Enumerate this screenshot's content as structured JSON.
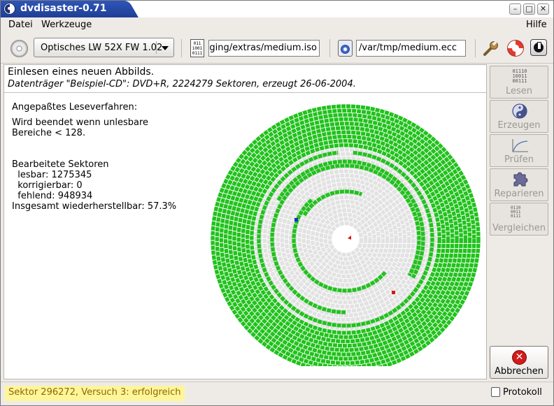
{
  "window": {
    "title": "dvdisaster-0.71",
    "controls": [
      "–",
      "□",
      "✕"
    ]
  },
  "menu": {
    "file": "Datei",
    "tools": "Werkzeuge",
    "help": "Hilfe"
  },
  "toolbar": {
    "drive": "Optisches LW 52X FW 1.02",
    "image_path": "aging/extras/medium.iso",
    "ecc_path": "/var/tmp/medium.ecc",
    "image_icon_text": "011\n1001\n0111"
  },
  "main": {
    "heading": "Einlesen eines neuen Abbilds.",
    "subheading": "Datenträger \"Beispiel-CD\": DVD+R, 2224279 Sektoren, erzeugt 26-06-2004.",
    "method_label": "Angepaßtes Leseverfahren:",
    "stop_line1": "Wird beendet wenn unlesbare",
    "stop_line2": "Bereiche < 128.",
    "processed_label": "Bearbeitete Sektoren",
    "readable": "  lesbar: 1275345",
    "correctable": "  korrigierbar: 0",
    "missing": "  fehlend: 948934",
    "recoverable": "Insgesamt wiederherstellbar: 57.3%"
  },
  "sidebar": {
    "read": "Lesen",
    "read_icon_text": "01110\n10011\n00111",
    "create": "Erzeugen",
    "verify": "Prüfen",
    "repair": "Reparieren",
    "compare": "Vergleichen",
    "compare_icon_text": "0110\n0011\n0111",
    "abort": "Abbrechen",
    "abort_glyph": "✕"
  },
  "status": {
    "message": "Sektor 296272, Versuch 3: erfolgreich",
    "log": "Protokoll"
  },
  "colors": {
    "read_ok": "#21c21c",
    "unread": "#e2e2e2",
    "title_bar": "#2a4fad",
    "status_highlight": "#fff59a"
  }
}
